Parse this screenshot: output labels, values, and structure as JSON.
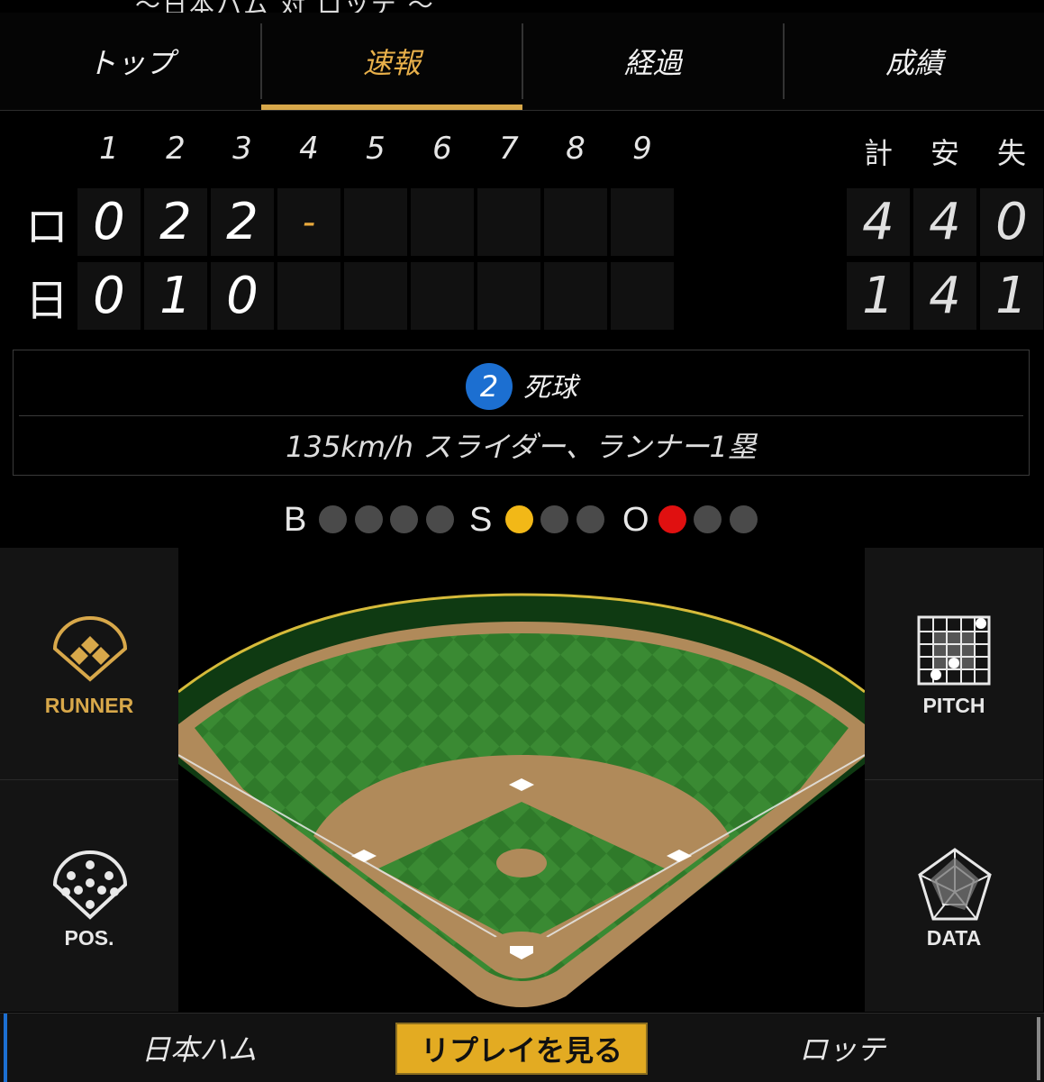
{
  "header": {
    "cutoff_text": "〜日本ハム 対 ロッテ 〜"
  },
  "tabs": [
    {
      "label": "トップ",
      "active": false
    },
    {
      "label": "速報",
      "active": true
    },
    {
      "label": "経過",
      "active": false
    },
    {
      "label": "成績",
      "active": false
    }
  ],
  "scoreboard": {
    "innings": [
      "1",
      "2",
      "3",
      "4",
      "5",
      "6",
      "7",
      "8",
      "9"
    ],
    "totals_headers": [
      "計",
      "安",
      "失"
    ],
    "teams": [
      {
        "abbr": "ロ",
        "innings": [
          "0",
          "2",
          "2",
          "-",
          "",
          "",
          "",
          "",
          ""
        ],
        "totals": [
          "4",
          "4",
          "0"
        ]
      },
      {
        "abbr": "日",
        "innings": [
          "0",
          "1",
          "0",
          "",
          "",
          "",
          "",
          "",
          ""
        ],
        "totals": [
          "1",
          "4",
          "1"
        ]
      }
    ]
  },
  "play": {
    "batter_number": "2",
    "result": "死球",
    "detail": "135km/h スライダー、ランナー1塁"
  },
  "count": {
    "balls_label": "B",
    "strikes_label": "S",
    "outs_label": "O",
    "balls": 0,
    "balls_max": 4,
    "strikes": 1,
    "strikes_max": 3,
    "outs": 1,
    "outs_max": 3
  },
  "side_buttons": {
    "runner": "RUNNER",
    "pitch": "PITCH",
    "pos": "POS.",
    "data": "DATA"
  },
  "bottom": {
    "home_team": "日本ハム",
    "replay": "リプレイを見る",
    "away_team": "ロッテ"
  },
  "colors": {
    "accent": "#d8a84a",
    "strike_on": "#f2b817",
    "out_on": "#e01010",
    "dot_off": "#4a4a4a",
    "badge": "#1c6fd1",
    "replay_bg": "#e3ab22"
  }
}
